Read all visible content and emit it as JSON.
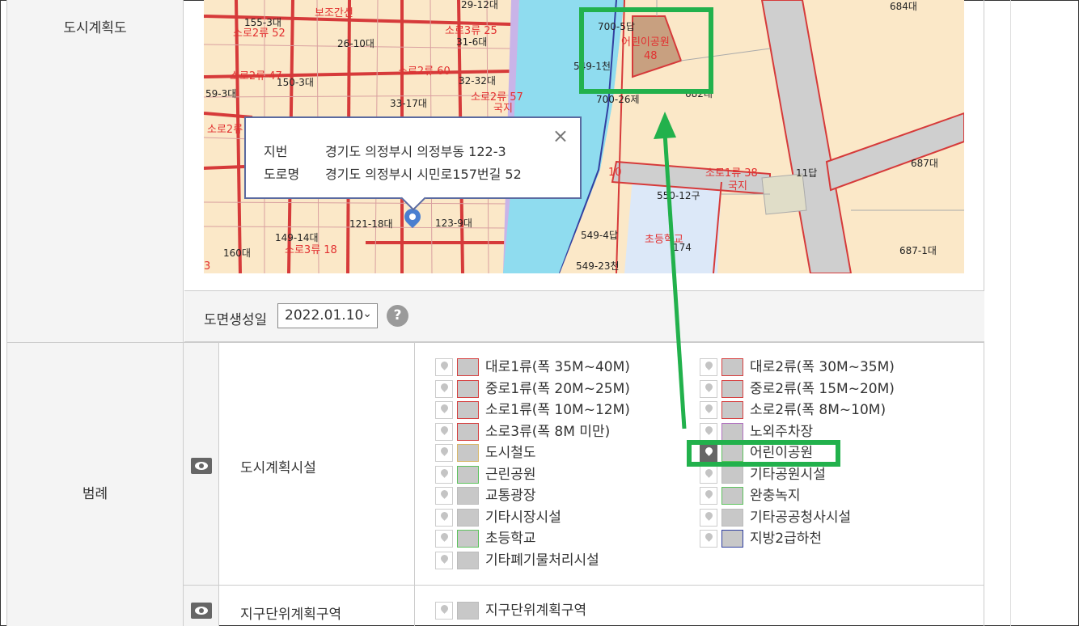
{
  "rows": {
    "plan_map_label": "도시계획도",
    "legend_label": "범례"
  },
  "map": {
    "labels": {
      "l01": "155-3대",
      "l02": "보조간선",
      "l03": "소로2류 52",
      "l04": "26-10대",
      "l05": "29-12대",
      "l06": "소로3류 25",
      "l07": "31-6대",
      "l08": "소로2류 60",
      "l09": "소로2류 47",
      "l10": "150-3대",
      "l11": "32-32대",
      "l12": "59-3대",
      "l13": "33-17대",
      "l14": "소로2류 57",
      "l15": "국지",
      "l16": "소로2류",
      "l17": "121-18대",
      "l18": "123-9대",
      "l19": "149-14대",
      "l20": "소로3류 18",
      "l21": "160대",
      "l22": "3",
      "l23": "700-5답",
      "l24": "549-1천",
      "l25": "700-26제",
      "l26": "682대",
      "l27": "684대",
      "l28": "어린이공원",
      "l29": "48",
      "l30": "10",
      "l31": "소로1류 38",
      "l32": "국지",
      "l33": "11답",
      "l34": "550-12구",
      "l35": "687대",
      "l36": "549-4답",
      "l37": "초등학교",
      "l38": "174",
      "l39": "549-23천",
      "l40": "687-1대"
    }
  },
  "popup": {
    "jibun_key": "지번",
    "jibun_value": "경기도 의정부시 의정부동 122-3",
    "road_key": "도로명",
    "road_value": "경기도 의정부시 시민로157번길 52",
    "close_icon": "×"
  },
  "date_row": {
    "label": "도면생성일",
    "selected": "2022.01.10",
    "help": "?"
  },
  "legend": {
    "group1": "도시계획시설",
    "group2": "지구단위계획구역",
    "left": [
      {
        "label": "대로1류(폭 35M~40M)",
        "color": "#d64040"
      },
      {
        "label": "중로1류(폭 20M~25M)",
        "color": "#d64040"
      },
      {
        "label": "소로1류(폭 10M~12M)",
        "color": "#d64040"
      },
      {
        "label": "소로3류(폭 8M 미만)",
        "color": "#d64040"
      },
      {
        "label": "도시철도",
        "color": "#d9b86a"
      },
      {
        "label": "근린공원",
        "color": "#5cc25c"
      },
      {
        "label": "교통광장",
        "color": "#bbbbbb"
      },
      {
        "label": "기타시장시설",
        "color": "#bbbbbb"
      },
      {
        "label": "초등학교",
        "color": "#5cc25c"
      },
      {
        "label": "기타폐기물처리시설",
        "color": "#bbbbbb"
      }
    ],
    "right": [
      {
        "label": "대로2류(폭 30M~35M)",
        "color": "#d64040"
      },
      {
        "label": "중로2류(폭 15M~20M)",
        "color": "#d64040"
      },
      {
        "label": "소로2류(폭 8M~10M)",
        "color": "#d64040"
      },
      {
        "label": "노외주차장",
        "color": "#b070c0"
      },
      {
        "label": "어린이공원",
        "color": "#5cc25c",
        "active": true
      },
      {
        "label": "기타공원시설",
        "color": "#bbbbbb"
      },
      {
        "label": "완충녹지",
        "color": "#5cc25c"
      },
      {
        "label": "기타공공청사시설",
        "color": "#bbbbbb"
      },
      {
        "label": "지방2급하천",
        "color": "#3040a0"
      }
    ],
    "group2_items": [
      {
        "label": "지구단위계획구역",
        "color": "#bbbbbb"
      }
    ]
  },
  "annotation_color": "#22b14c"
}
